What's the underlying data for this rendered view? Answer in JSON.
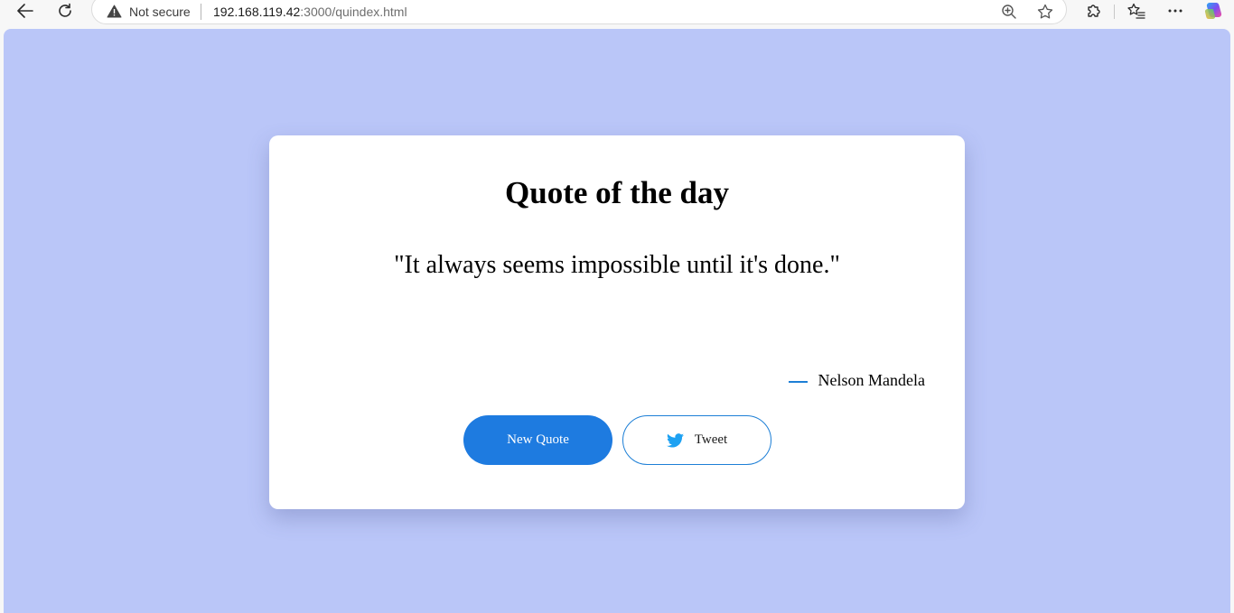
{
  "browser": {
    "security_label": "Not secure",
    "url_host": "192.168.119.42",
    "url_path": ":3000/quindex.html"
  },
  "page": {
    "title": "Quote of the day",
    "quote": "\"It always seems impossible until it's done.\"",
    "author": "Nelson Mandela",
    "new_quote_label": "New Quote",
    "tweet_label": "Tweet"
  },
  "colors": {
    "page_background": "#bac6f8",
    "card_background": "#ffffff",
    "accent": "#1e7be0",
    "twitter_blue": "#1da1f2"
  },
  "icons": [
    "back-arrow-icon",
    "refresh-icon",
    "warning-icon",
    "zoom-icon",
    "favorite-star-icon",
    "extensions-icon",
    "favorites-icon",
    "more-icon",
    "copilot-icon",
    "twitter-bird-icon"
  ]
}
